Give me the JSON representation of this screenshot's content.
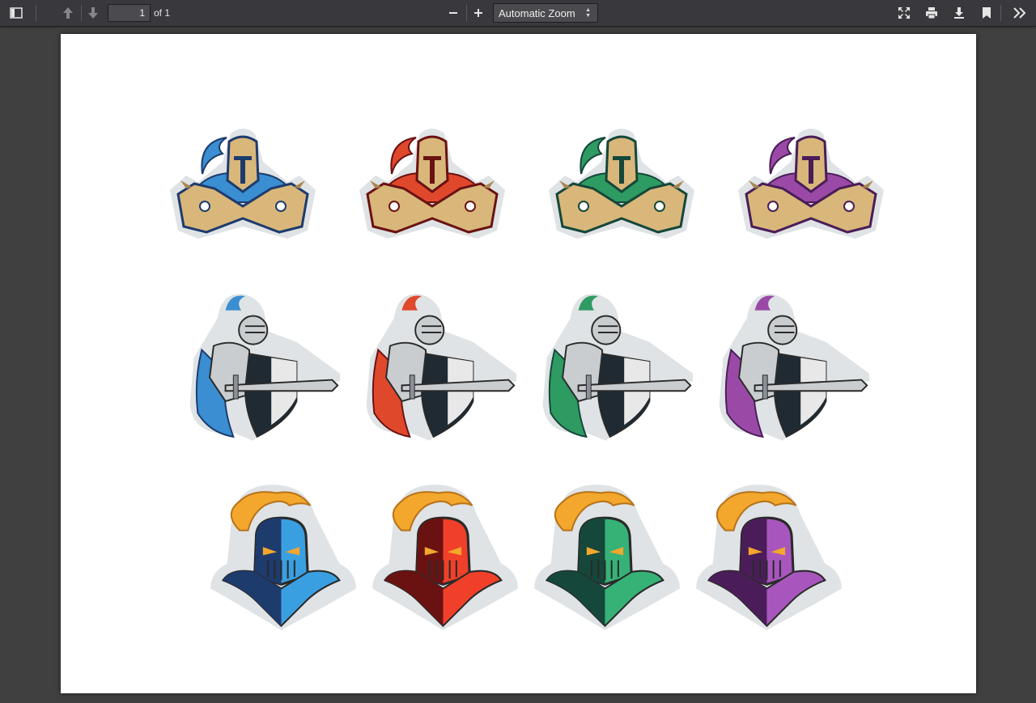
{
  "toolbar": {
    "page_number": "1",
    "page_count": "of 1",
    "zoom": "Automatic Zoom",
    "icons": {
      "sidebar": "sidebar-toggle-icon",
      "prev": "arrow-up-icon",
      "next": "arrow-down-icon",
      "zoom_out": "minus-icon",
      "zoom_in": "plus-icon",
      "presentation": "fullscreen-icon",
      "print": "printer-icon",
      "download": "download-icon",
      "bookmark": "bookmark-icon",
      "tools": "double-chevron-right-icon"
    }
  },
  "document": {
    "rows": [
      {
        "style": "knight-helmet-shoulders-logo",
        "colors": [
          "#3a8ed1",
          "#e0482c",
          "#2e9b62",
          "#9a4aa6"
        ]
      },
      {
        "style": "knight-with-sword-and-shield-logo",
        "colors": [
          "#3a8ed1",
          "#e0482c",
          "#2e9b62",
          "#9a4aa6"
        ]
      },
      {
        "style": "knight-bust-logo",
        "colors": [
          "#3a9fe0",
          "#f0402a",
          "#36b277",
          "#a856bd"
        ]
      }
    ],
    "dark_colors": [
      "#1e3b6e",
      "#6a1212",
      "#15473a",
      "#4a1d58"
    ]
  }
}
